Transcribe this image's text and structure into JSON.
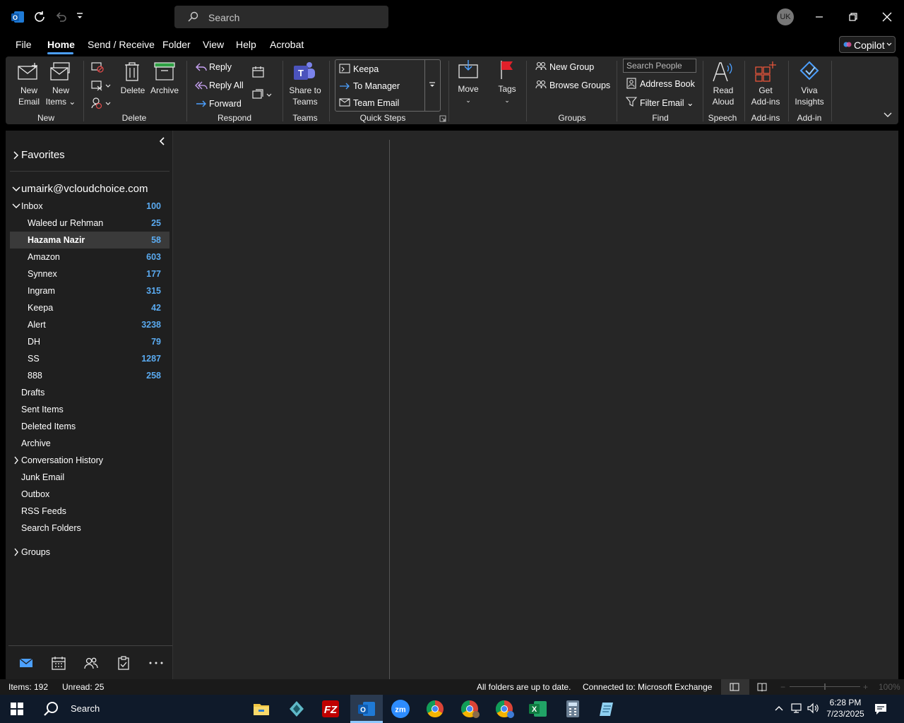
{
  "title_bar": {
    "search_placeholder": "Search",
    "user_initials": "UK"
  },
  "menu": {
    "file": "File",
    "home": "Home",
    "send_receive": "Send / Receive",
    "folder": "Folder",
    "view": "View",
    "help": "Help",
    "acrobat": "Acrobat",
    "copilot": "Copilot"
  },
  "ribbon": {
    "new_email": [
      "New",
      "Email"
    ],
    "new_items": [
      "New",
      "Items"
    ],
    "group_new": "New",
    "delete": "Delete",
    "archive": "Archive",
    "group_delete": "Delete",
    "reply": "Reply",
    "reply_all": "Reply All",
    "forward": "Forward",
    "group_respond": "Respond",
    "share_to_teams": [
      "Share to",
      "Teams"
    ],
    "group_teams": "Teams",
    "quick_steps": [
      "Keepa",
      "To Manager",
      "Team Email"
    ],
    "group_quick_steps": "Quick Steps",
    "move": "Move",
    "tags": "Tags",
    "new_group": "New Group",
    "browse_groups": "Browse Groups",
    "group_groups": "Groups",
    "search_people_placeholder": "Search People",
    "address_book": "Address Book",
    "filter_email": "Filter Email",
    "group_find": "Find",
    "read_aloud": [
      "Read",
      "Aloud"
    ],
    "group_speech": "Speech",
    "get_addins": [
      "Get",
      "Add-ins"
    ],
    "group_addins": "Add-ins",
    "viva_insights": [
      "Viva",
      "Insights"
    ],
    "group_addin": "Add-in"
  },
  "nav": {
    "favorites": "Favorites",
    "account": "umairk@vcloudchoice.com",
    "inbox": {
      "name": "Inbox",
      "count": "100"
    },
    "subfolders": [
      {
        "name": "Waleed ur Rehman",
        "count": "25"
      },
      {
        "name": "Hazama Nazir",
        "count": "58"
      },
      {
        "name": "Amazon",
        "count": "603"
      },
      {
        "name": "Synnex",
        "count": "177"
      },
      {
        "name": "Ingram",
        "count": "315"
      },
      {
        "name": "Keepa",
        "count": "42"
      },
      {
        "name": "Alert",
        "count": "3238"
      },
      {
        "name": "DH",
        "count": "79"
      },
      {
        "name": "SS",
        "count": "1287"
      },
      {
        "name": "888",
        "count": "258"
      }
    ],
    "folders": [
      "Drafts",
      "Sent Items",
      "Deleted Items",
      "Archive",
      "Conversation History",
      "Junk Email",
      "Outbox",
      "RSS Feeds",
      "Search Folders"
    ],
    "groups": "Groups"
  },
  "status": {
    "items": "Items: 192",
    "unread": "Unread: 25",
    "sync": "All folders are up to date.",
    "connected": "Connected to: Microsoft Exchange",
    "zoom": "100%"
  },
  "taskbar": {
    "search": "Search",
    "time": "6:28 PM",
    "date": "7/23/2025"
  },
  "colors": {
    "accent": "#4ca0ff",
    "count_blue": "#5aaaf0",
    "flag_red": "#e0202a"
  }
}
